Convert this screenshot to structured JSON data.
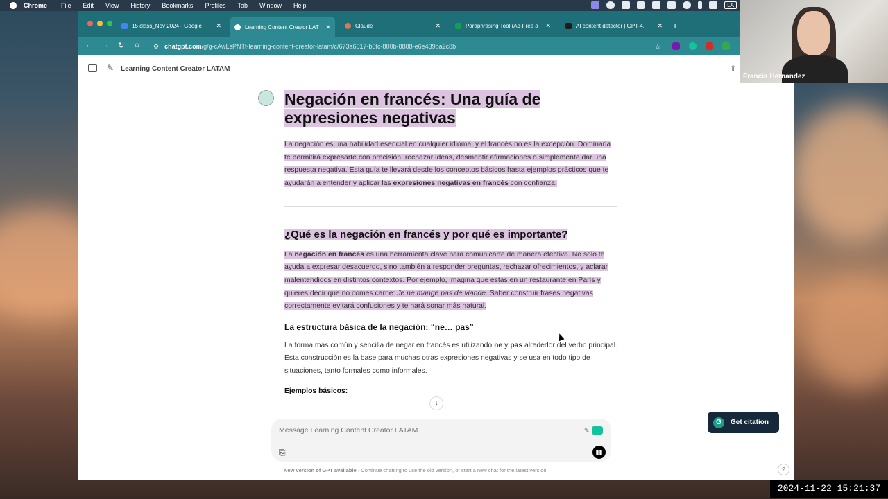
{
  "menubar": {
    "app": "Chrome",
    "items": [
      "File",
      "Edit",
      "View",
      "History",
      "Bookmarks",
      "Profiles",
      "Tab",
      "Window",
      "Help"
    ],
    "input_source": "LA"
  },
  "tabs": [
    {
      "label": "15 class_Nov 2024 - Google",
      "icon": "docs-icon"
    },
    {
      "label": "Learning Content Creator LAT",
      "icon": "chatgpt-icon"
    },
    {
      "label": "Claude",
      "icon": "claude-icon"
    },
    {
      "label": "Paraphrasing Tool (Ad-Free a",
      "icon": "sheets-icon"
    },
    {
      "label": "AI content detector | GPT-4,",
      "icon": "detector-icon"
    }
  ],
  "url": {
    "host": "chatgpt.com",
    "path": "/g/g-cAwLsPNTt-learning-content-creator-latam/c/673a6017-b0fc-800b-8888-e6e439ba2c8b"
  },
  "chat": {
    "gpt_name": "Learning Content Creator LATAM",
    "heading": "Negación en francés: Una guía de expresiones negativas",
    "intro_parts": [
      "La negación es una habilidad esencial en cualquier idioma, y el francés no es la excepción. Dominarla te permitirá expresarte con precisión, rechazar ideas, desmentir afirmaciones o simplemente dar una respuesta negativa. Esta guía te llevará desde los conceptos básicos hasta ejemplos prácticos que te ayudarán a entender y aplicar las ",
      "expresiones negativas en francés",
      " con confianza."
    ],
    "h2": "¿Qué es la negación en francés y por qué es importante?",
    "p2_parts": [
      "La ",
      "negación en francés",
      " es una herramienta clave para comunicarte de manera efectiva. No solo te ayuda a expresar desacuerdo, sino también a responder preguntas, rechazar ofrecimientos, y aclarar malentendidos en distintos contextos. Por ejemplo, imagina que estás en un restaurante en París y quieres decir que no comes carne: ",
      "Je ne mange pas de viande",
      ". Saber construir frases negativas correctamente evitará confusiones y te hará sonar más natural."
    ],
    "h3": "La estructura básica de la negación: “ne… pas”",
    "p3_parts": [
      "La forma más común y sencilla de negar en francés es utilizando ",
      "ne",
      " y ",
      "pas",
      " alrededor del verbo principal. Esta construcción es la base para muchas otras expresiones negativas y se usa en todo tipo de situaciones, tanto formales como informales."
    ],
    "h4": "Ejemplos básicos:",
    "input_placeholder": "Message Learning Content Creator LATAM",
    "footer_bold": "New version of GPT available",
    "footer_text": " - Continue chatting to use the old version, or start a ",
    "footer_link": "new chat",
    "footer_end": " for the latest version."
  },
  "citation_button": "Get citation",
  "webcam": {
    "name": "Francia Hernandez"
  },
  "timestamp": "2024-11-22  15:21:37"
}
